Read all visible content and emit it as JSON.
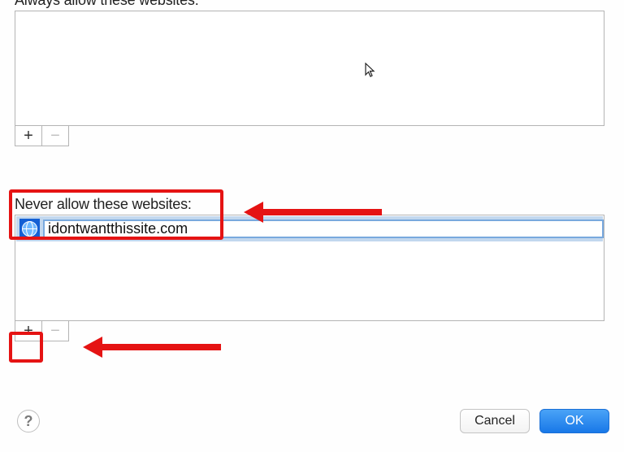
{
  "always_section": {
    "label": "Always allow these websites:",
    "items": []
  },
  "never_section": {
    "label": "Never allow these websites:",
    "entry_value": "idontwantthissite.com"
  },
  "buttons": {
    "add": "+",
    "remove": "−",
    "cancel": "Cancel",
    "ok": "OK",
    "help": "?"
  },
  "annotation": {
    "color": "#e51313"
  }
}
